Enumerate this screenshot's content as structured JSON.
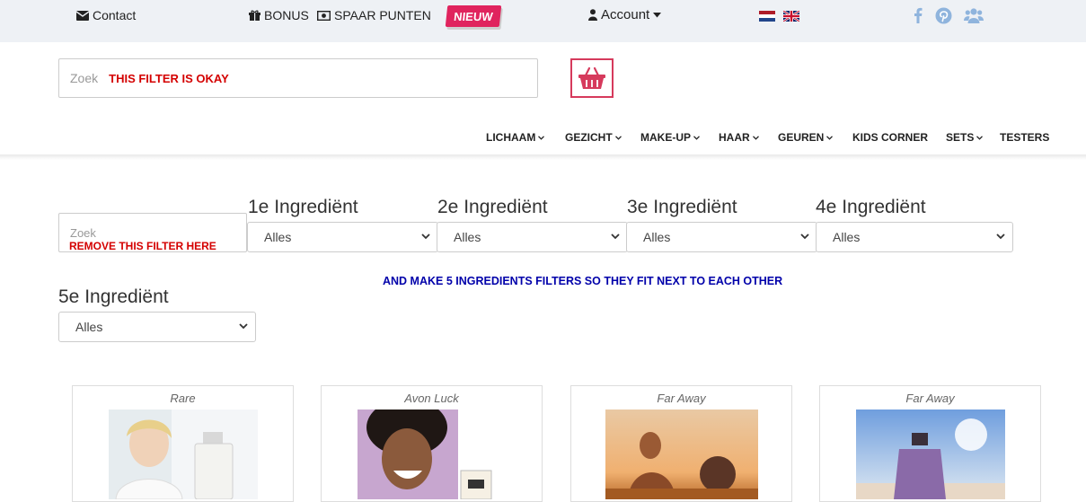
{
  "topbar": {
    "contact": "Contact",
    "bonus": "BONUS",
    "spaar": "SPAAR PUNTEN",
    "nieuw": "NIEUW",
    "account": "Account"
  },
  "search_top": {
    "placeholder": "Zoek",
    "note": "THIS FILTER IS OKAY"
  },
  "nav": {
    "items": [
      "LICHAAM",
      "GEZICHT",
      "MAKE-UP",
      "HAAR",
      "GEUREN",
      "KIDS CORNER",
      "SETS",
      "TESTERS"
    ]
  },
  "filters": {
    "search_placeholder": "Zoek",
    "search_note": "REMOVE THIS FILTER HERE",
    "ingredients": [
      {
        "label": "1e Ingrediënt",
        "value": "Alles"
      },
      {
        "label": "2e Ingrediënt",
        "value": "Alles"
      },
      {
        "label": "3e Ingrediënt",
        "value": "Alles"
      },
      {
        "label": "4e Ingrediënt",
        "value": "Alles"
      },
      {
        "label": "5e Ingrediënt",
        "value": "Alles"
      }
    ],
    "note": "AND MAKE 5 INGREDIENTS FILTERS SO THEY FIT NEXT TO EACH OTHER"
  },
  "products": [
    {
      "name": "Rare"
    },
    {
      "name": "Avon Luck"
    },
    {
      "name": "Far Away"
    },
    {
      "name": "Far Away"
    }
  ],
  "colors": {
    "accent_red": "#d40000",
    "brand_pink": "#e0245e",
    "note_blue": "#0000aa",
    "social_blue": "#8fb4dd"
  }
}
